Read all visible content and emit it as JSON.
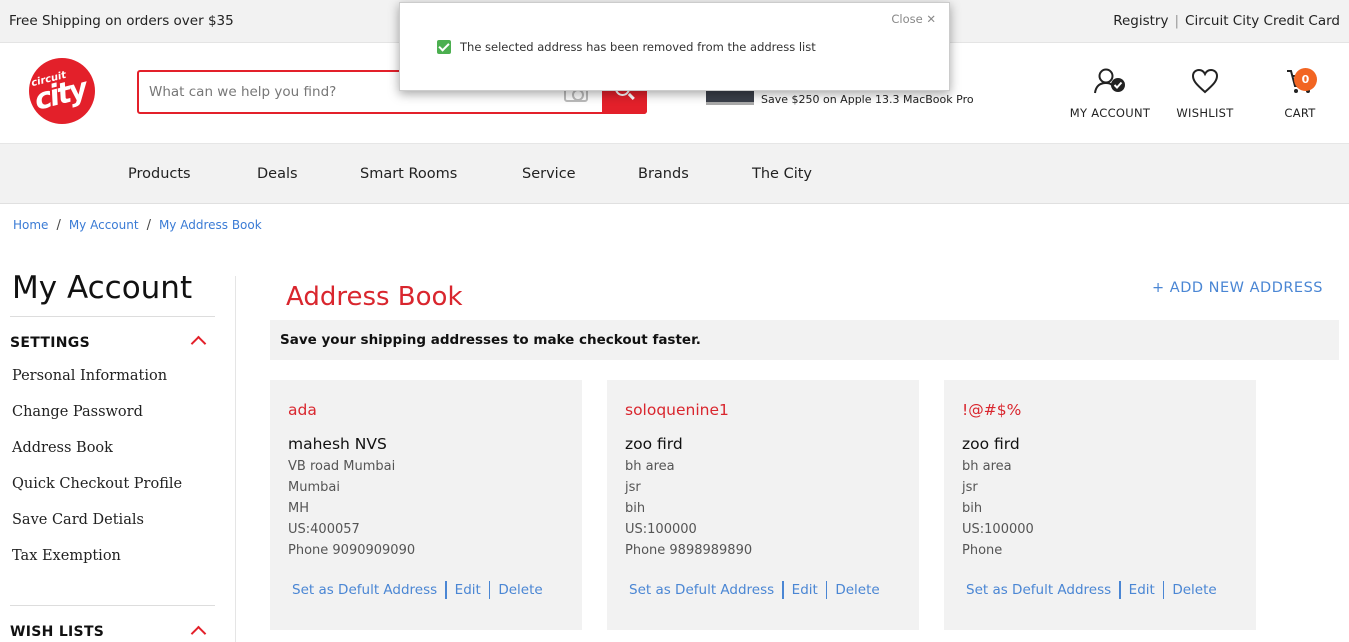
{
  "topbar": {
    "promo": "Free Shipping on orders over $35",
    "links": [
      "Registry",
      "Circuit City Credit Card"
    ]
  },
  "logo": {
    "line1": "circuit",
    "line2": "city"
  },
  "search": {
    "placeholder": "What can we help you find?"
  },
  "promo_banner": {
    "text": "Save $250 on Apple 13.3 MacBook Pro"
  },
  "header_icons": {
    "account": "MY ACCOUNT",
    "wishlist": "WISHLIST",
    "cart": "CART",
    "cart_count": "0"
  },
  "nav": [
    "Products",
    "Deals",
    "Smart Rooms",
    "Service",
    "Brands",
    "The City"
  ],
  "breadcrumb": [
    "Home",
    "My Account",
    "My Address Book"
  ],
  "sidebar": {
    "title": "My Account",
    "settings_heading": "SETTINGS",
    "links": [
      "Personal Information",
      "Change Password",
      "Address Book",
      "Quick Checkout Profile",
      "Save Card Detials",
      "Tax Exemption"
    ],
    "wishlists_heading": "WISH LISTS"
  },
  "main": {
    "title": "Address Book",
    "add_new": "+ ADD NEW ADDRESS",
    "info": "Save your shipping addresses to make checkout faster."
  },
  "addresses": [
    {
      "nickname": "ada",
      "name": "mahesh NVS",
      "lines": [
        "VB road Mumbai",
        "Mumbai",
        "MH",
        "US:400057",
        "Phone 9090909090"
      ]
    },
    {
      "nickname": "soloquenine1",
      "name": "zoo fird",
      "lines": [
        "bh area",
        "jsr",
        "bih",
        "US:100000",
        "Phone 9898989890"
      ]
    },
    {
      "nickname": "!@#$%",
      "name": "zoo fird",
      "lines": [
        "bh area",
        "jsr",
        "bih",
        "US:100000",
        "Phone"
      ]
    }
  ],
  "card_actions": {
    "set_default": "Set as Defult Address",
    "edit": "Edit",
    "delete": "Delete"
  },
  "toast": {
    "close": "Close ✕",
    "message": "The selected address has been removed from the address list"
  },
  "colors": {
    "brand_red": "#e3202a",
    "link_blue": "#4a86d4",
    "badge_orange": "#f26522",
    "success_green": "#4caf50"
  }
}
